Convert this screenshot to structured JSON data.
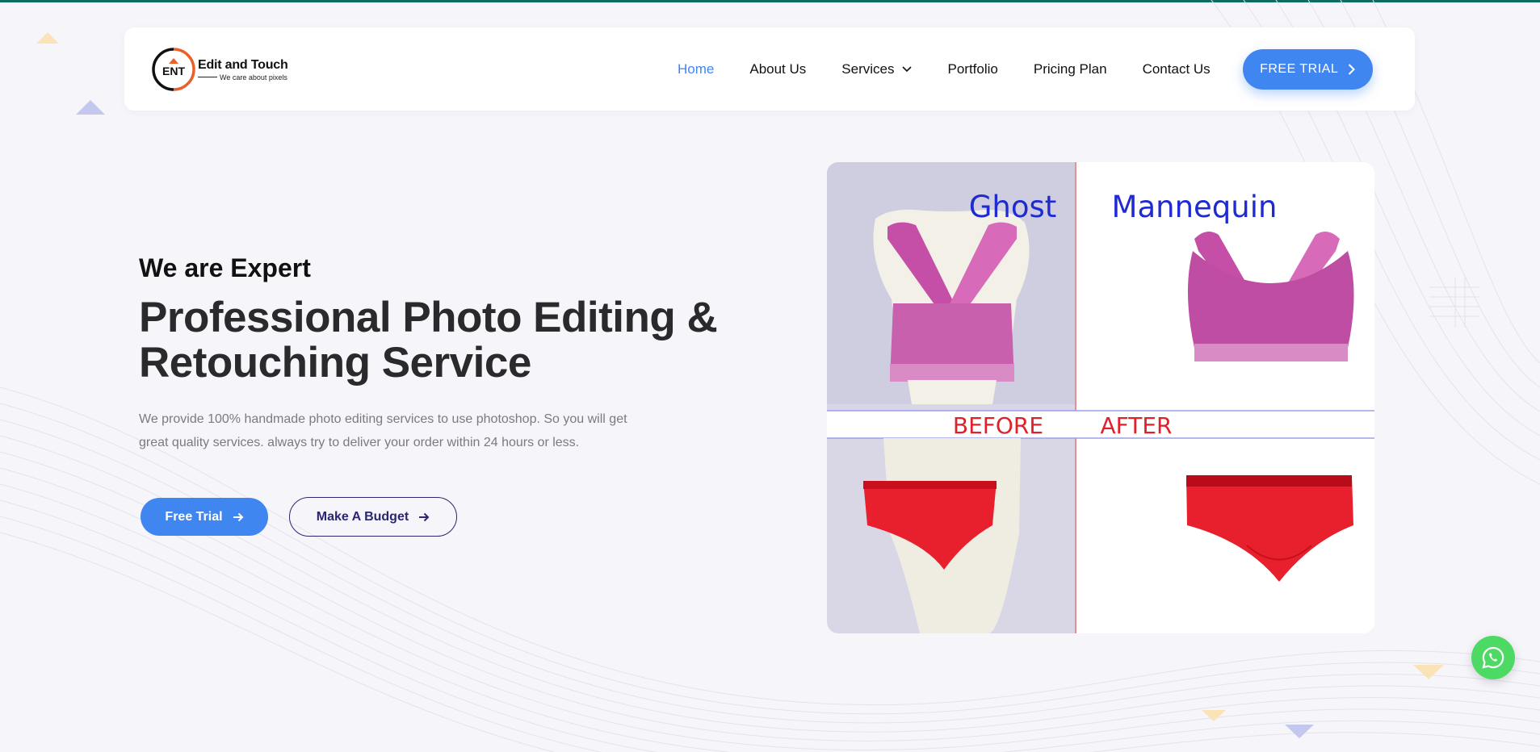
{
  "brand": {
    "logo_mark_text": "ENT",
    "name": "Edit and Touch",
    "tagline": "We care about pixels"
  },
  "nav": {
    "items": [
      {
        "label": "Home",
        "active": true
      },
      {
        "label": "About Us",
        "active": false
      },
      {
        "label": "Services",
        "active": false,
        "has_dropdown": true
      },
      {
        "label": "Portfolio",
        "active": false
      },
      {
        "label": "Pricing Plan",
        "active": false
      },
      {
        "label": "Contact Us",
        "active": false
      }
    ],
    "cta_label": "FREE TRIAL"
  },
  "hero": {
    "subtitle": "We are Expert",
    "title_line1": "Professional Photo Editing &",
    "title_line2": "Retouching Service",
    "desc_line1": "We provide 100% handmade photo editing services to use photoshop. So you will get",
    "desc_line2": "great quality services. always try to deliver your order within 24 hours or less.",
    "primary_button": "Free Trial",
    "secondary_button": "Make A Budget"
  },
  "showcase": {
    "title_left": "Ghost",
    "title_right": "Mannequin",
    "label_before": "BEFORE",
    "label_after": "AFTER"
  },
  "colors": {
    "accent": "#3f86f0",
    "dark_navy": "#2a2672",
    "whatsapp": "#4cd964",
    "top_strip": "#0e6b62"
  },
  "icons": {
    "services_dropdown": "chevron-down-icon",
    "cta": "chevron-right-icon",
    "buttons": "arrow-right-icon",
    "floating": "whatsapp-icon"
  }
}
